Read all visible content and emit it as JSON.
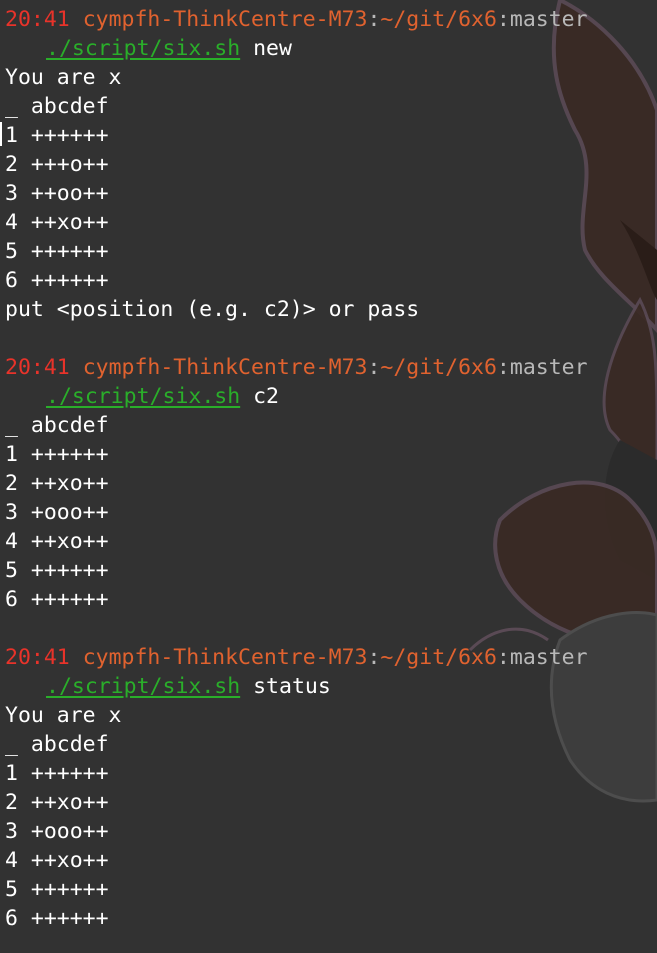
{
  "prompt": {
    "time": "20:41",
    "host": "cympfh-ThinkCentre-M73",
    "path_sep": ":",
    "path": "~/git/6x6",
    "branch_sep": ":",
    "branch": "master",
    "script": "./script/six.sh"
  },
  "commands": [
    {
      "arg": " new",
      "output": [
        "You are x",
        "_ abcdef",
        "1 ++++++",
        "2 +++o++",
        "3 ++oo++",
        "4 ++xo++",
        "5 ++++++",
        "6 ++++++",
        "put <position (e.g. c2)> or pass"
      ]
    },
    {
      "arg": " c2",
      "output": [
        "_ abcdef",
        "1 ++++++",
        "2 ++xo++",
        "3 +ooo++",
        "4 ++xo++",
        "5 ++++++",
        "6 ++++++"
      ]
    },
    {
      "arg": " status",
      "output": [
        "You are x",
        "_ abcdef",
        "1 ++++++",
        "2 ++xo++",
        "3 +ooo++",
        "4 ++xo++",
        "5 ++++++",
        "6 ++++++"
      ]
    }
  ],
  "colors": {
    "background": "#323232",
    "time": "#e8332a",
    "host": "#e0622f",
    "separator": "#b8b8b8",
    "script": "#2aae2a",
    "text": "#ffffff"
  }
}
